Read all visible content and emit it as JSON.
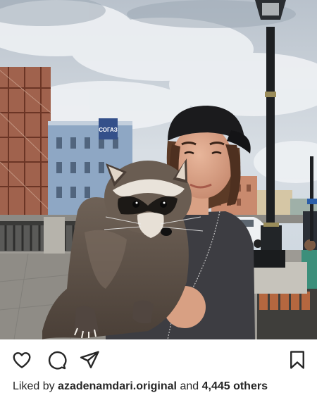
{
  "post": {
    "likes": {
      "prefix": "Liked by",
      "user": "azadenamdari.original",
      "connector": "and",
      "count": "4,445 others"
    },
    "photo": {
      "sign_text": "СОГАЗ"
    },
    "icons": {
      "like": "heart-icon",
      "comment": "comment-bubble-icon",
      "share": "paper-plane-icon",
      "save": "bookmark-icon"
    }
  }
}
